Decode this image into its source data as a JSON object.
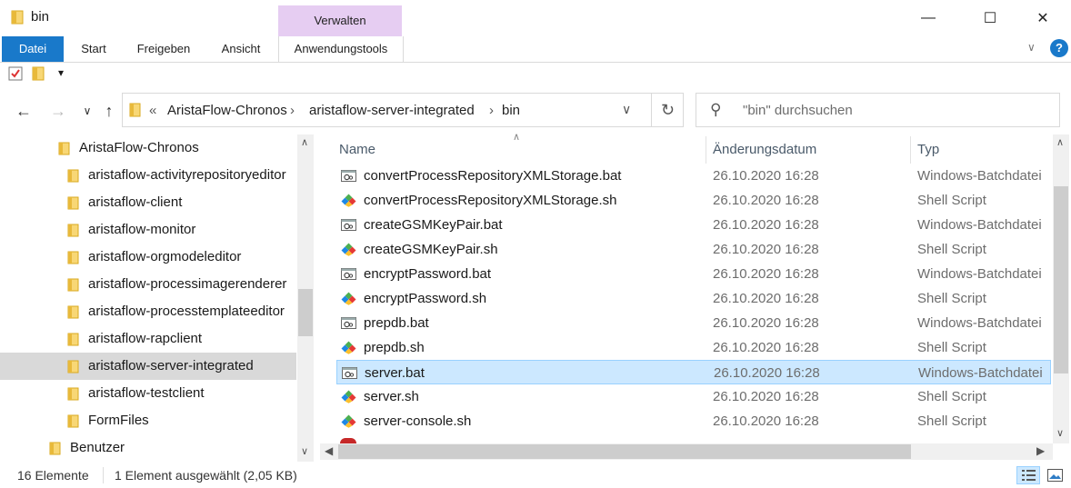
{
  "window": {
    "title": "bin",
    "minimize": "—",
    "maximize": "☐",
    "close": "✕"
  },
  "ribbon": {
    "context_header": "Verwalten",
    "tabs": [
      "Datei",
      "Start",
      "Freigeben",
      "Ansicht",
      "Anwendungstools"
    ],
    "help": "?"
  },
  "quick_access": {
    "dropdown": "▾"
  },
  "address": {
    "prefix": "«",
    "crumbs": [
      "AristaFlow-Chronos",
      "aristaflow-server-integrated",
      "bin"
    ],
    "separator": "›"
  },
  "search": {
    "placeholder": "\"bin\" durchsuchen"
  },
  "nav_pane": {
    "items": [
      {
        "label": "AristaFlow-Chronos"
      },
      {
        "label": "aristaflow-activityrepositoryeditor"
      },
      {
        "label": "aristaflow-client"
      },
      {
        "label": "aristaflow-monitor"
      },
      {
        "label": "aristaflow-orgmodeleditor"
      },
      {
        "label": "aristaflow-processimagerenderer"
      },
      {
        "label": "aristaflow-processtemplateeditor"
      },
      {
        "label": "aristaflow-rapclient"
      },
      {
        "label": "aristaflow-server-integrated"
      },
      {
        "label": "aristaflow-testclient"
      },
      {
        "label": "FormFiles"
      },
      {
        "label": "Benutzer"
      }
    ],
    "selected_index": 8
  },
  "file_list": {
    "columns": {
      "name": "Name",
      "date": "Änderungsdatum",
      "type": "Typ"
    },
    "rows": [
      {
        "name": "convertProcessRepositoryXMLStorage.bat",
        "date": "26.10.2020 16:28",
        "type": "Windows-Batchdatei",
        "icon": "batch-file-icon"
      },
      {
        "name": "convertProcessRepositoryXMLStorage.sh",
        "date": "26.10.2020 16:28",
        "type": "Shell Script",
        "icon": "shell-script-icon"
      },
      {
        "name": "createGSMKeyPair.bat",
        "date": "26.10.2020 16:28",
        "type": "Windows-Batchdatei",
        "icon": "batch-file-icon"
      },
      {
        "name": "createGSMKeyPair.sh",
        "date": "26.10.2020 16:28",
        "type": "Shell Script",
        "icon": "shell-script-icon"
      },
      {
        "name": "encryptPassword.bat",
        "date": "26.10.2020 16:28",
        "type": "Windows-Batchdatei",
        "icon": "batch-file-icon"
      },
      {
        "name": "encryptPassword.sh",
        "date": "26.10.2020 16:28",
        "type": "Shell Script",
        "icon": "shell-script-icon"
      },
      {
        "name": "prepdb.bat",
        "date": "26.10.2020 16:28",
        "type": "Windows-Batchdatei",
        "icon": "batch-file-icon"
      },
      {
        "name": "prepdb.sh",
        "date": "26.10.2020 16:28",
        "type": "Shell Script",
        "icon": "shell-script-icon"
      },
      {
        "name": "server.bat",
        "date": "26.10.2020 16:28",
        "type": "Windows-Batchdatei",
        "icon": "batch-file-icon"
      },
      {
        "name": "server.sh",
        "date": "26.10.2020 16:28",
        "type": "Shell Script",
        "icon": "shell-script-icon"
      },
      {
        "name": "server-console.sh",
        "date": "26.10.2020 16:28",
        "type": "Shell Script",
        "icon": "shell-script-icon"
      }
    ],
    "selected_index": 8
  },
  "status_bar": {
    "count": "16 Elemente",
    "selection": "1 Element ausgewählt (2,05 KB)"
  },
  "colors": {
    "accent": "#1979ca",
    "context_tab": "#e6cdf2",
    "selection": "#cce8ff",
    "folder": "#f8d775"
  }
}
